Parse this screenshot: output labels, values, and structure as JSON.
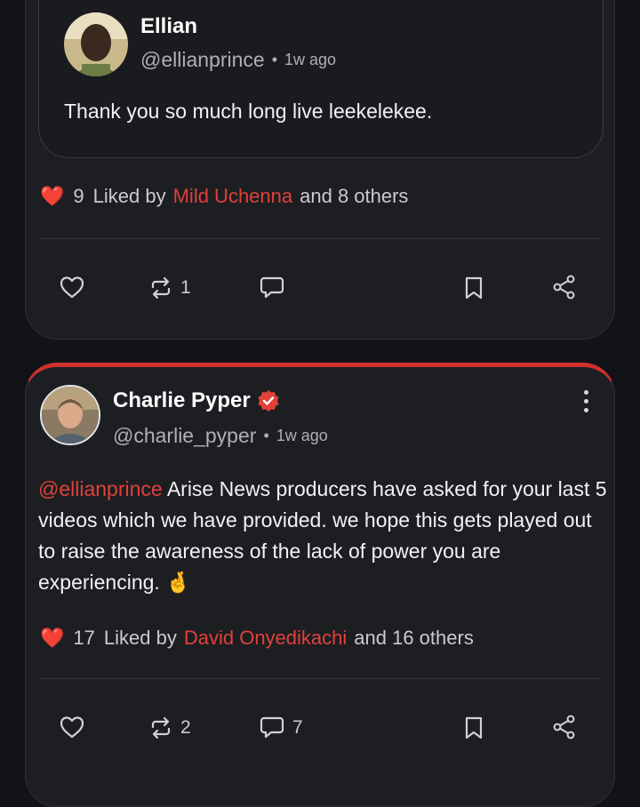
{
  "post1": {
    "quoted": {
      "name": "Ellian",
      "handle": "@ellianprince",
      "separator": "•",
      "time": "1w ago",
      "text": "Thank you so much long live leekelekee."
    },
    "likes": {
      "heart": "❤️",
      "count": "9",
      "prefix": "Liked by",
      "liker": "Mild Uchenna",
      "suffix": "and 8 others"
    },
    "actions": {
      "repost_count": "1"
    }
  },
  "post2": {
    "name": "Charlie Pyper",
    "handle": "@charlie_pyper",
    "separator": "•",
    "time": "1w ago",
    "mention": "@ellianprince",
    "text_after_mention": " Arise News producers have asked for your last 5 videos which we have provided. we hope this gets played out to raise the awareness of the lack of power you are experiencing. 🤞",
    "likes": {
      "heart": "❤️",
      "count": "17",
      "prefix": "Liked by",
      "liker": "David Onyedikachi",
      "suffix": "and 16 others"
    },
    "actions": {
      "repost_count": "2",
      "comment_count": "7"
    }
  },
  "colors": {
    "accent": "#e0413a",
    "card_bg": "#1d1e22",
    "page_bg": "#121317",
    "verified": "#e0413a"
  },
  "icons": [
    "heart-icon",
    "repost-icon",
    "comment-icon",
    "bookmark-icon",
    "share-icon",
    "verified-badge-icon",
    "more-vert-icon"
  ]
}
